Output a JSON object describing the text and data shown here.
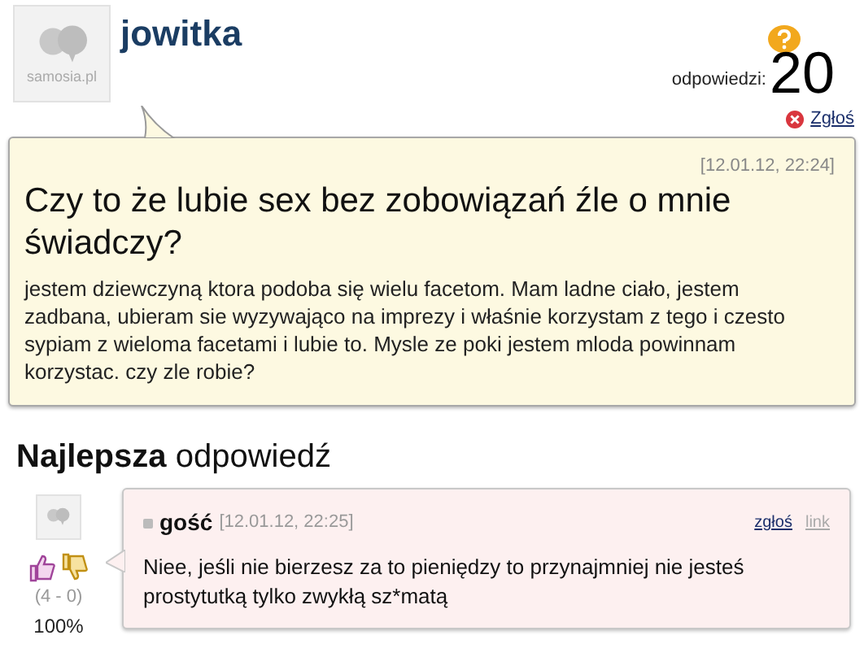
{
  "question": {
    "author": "jowitka",
    "avatar_logo": "samosia.pl",
    "answers_label": "odpowiedzi:",
    "answers_count": "20",
    "report": "Zgłoś",
    "date": "[12.01.12, 22:24]",
    "title": "Czy to że lubie sex bez zobowiązań źle o mnie świadczy?",
    "body": "jestem dziewczyną ktora podoba się wielu facetom. Mam ladne ciało, jestem zadbana, ubieram sie wyzywająco na imprezy i właśnie korzystam z tego i czesto sypiam z wieloma facetami i lubie to. Mysle ze poki jestem mloda powinnam korzystac. czy zle robie?"
  },
  "best_answer": {
    "heading": "**Najlepsza** odpowiedź",
    "author": "gość",
    "date": "[12.01.12, 22:25]",
    "report": "zgłoś",
    "link": "link",
    "text": "Niee, jeśli nie bierzesz za to pieniędzy to przynajmniej nie jesteś prostytutką tylko zwykłą sz*matą",
    "votes": "(4 - 0)",
    "percent": "100%"
  }
}
